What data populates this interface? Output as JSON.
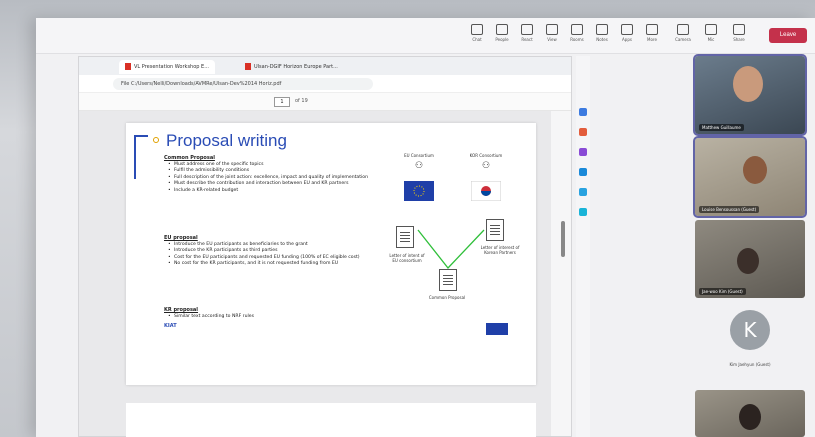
{
  "teams": {
    "toolbar": [
      "Chat",
      "People",
      "React",
      "View",
      "Rooms",
      "Notes",
      "Apps",
      "More",
      "Camera",
      "Mic",
      "Share"
    ],
    "leave_label": "Leave"
  },
  "browser": {
    "tabs": [
      "VL Presentation Workshop E...",
      "Ulsan-DGIF Horizon Europe Part..."
    ],
    "url": "File  C:/Users/Nelli/Downloads/AVMRe/Ulsan-Dev%2014 Horiz.pdf",
    "page": "1",
    "page_count": "of 19"
  },
  "slide": {
    "title": "Proposal writing",
    "common_heading": "Common Proposal",
    "common_items": [
      "Must address one of the specific topics",
      "Fulfil the admissibility conditions",
      "Full description of the joint action: excellence, impact and quality of implementation",
      "Must describe the contribution and interaction between EU and KR partners",
      "Include a KR-related budget"
    ],
    "eu_heading": "EU proposal",
    "eu_items": [
      "Introduce the EU participants as beneficiaries to the grant",
      "Introduce the KR participants as third parties",
      "Cost for the EU participants and requested EU funding (100% of EC eligible cost)",
      "No cost for the KR participants, and it is not requested funding from EU"
    ],
    "kr_heading": "KR proposal",
    "kr_items": [
      "Similar text according to NRF rules"
    ],
    "diagram": {
      "eu_label": "EU Consortium",
      "kr_label": "KOR Consortium",
      "left_doc": "Letter of intent of EU consortium",
      "right_doc": "Letter of interest of Korean Partners",
      "center": "Common Proposal"
    },
    "logo": "KIAT"
  },
  "participants": [
    {
      "name": "Matthew Guillaume"
    },
    {
      "name": "Louise Bensoussan (Guest)"
    },
    {
      "name": "Jae-woo Kim (Guest)"
    },
    {
      "name": "Kim Jaehyun (Guest)",
      "initials": "K"
    },
    {
      "name": ""
    }
  ]
}
